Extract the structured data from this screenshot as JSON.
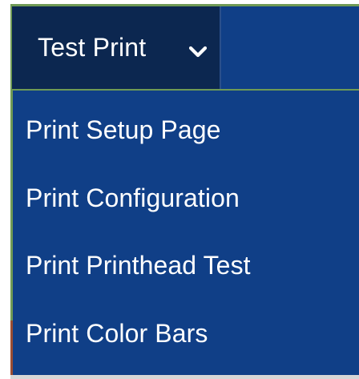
{
  "menu": {
    "tab_label": "Test Print",
    "tab_icon": "chevron-down-icon",
    "items": [
      {
        "label": "Print Setup Page"
      },
      {
        "label": "Print Configuration"
      },
      {
        "label": "Print Printhead Test"
      },
      {
        "label": "Print Color Bars"
      }
    ]
  },
  "colors": {
    "bar_background": "#103f87",
    "active_tab_background": "#0c2750",
    "text": "#ffffff",
    "border_accent": "#6f9a55"
  }
}
